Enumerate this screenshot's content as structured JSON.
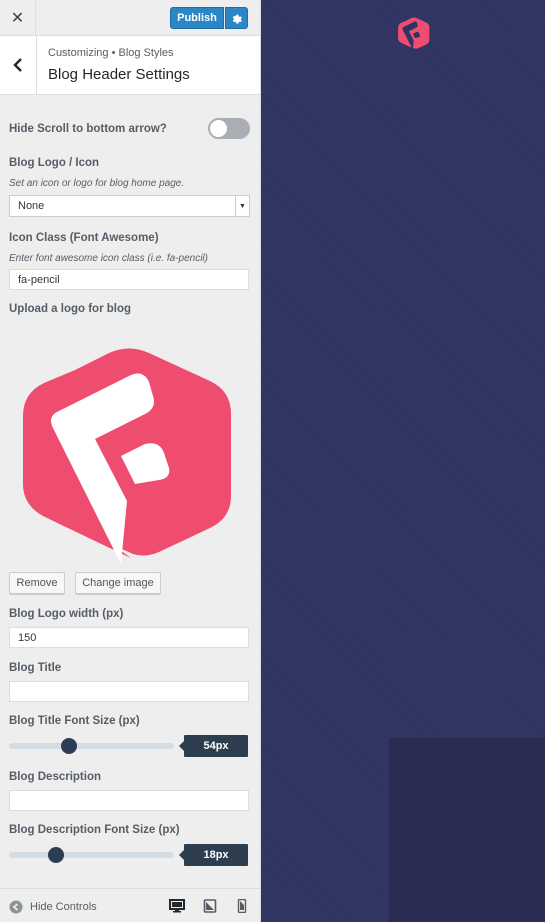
{
  "header": {
    "close_symbol": "✕",
    "publish_label": "Publish",
    "settings_icon": "gear-icon"
  },
  "section": {
    "breadcrumb": "Customizing • Blog Styles",
    "title": "Blog Header Settings"
  },
  "controls": {
    "scroll_arrow": {
      "label": "Hide Scroll to bottom arrow?",
      "enabled": false
    },
    "blog_logo_icon": {
      "label": "Blog Logo / Icon",
      "description": "Set an icon or logo for blog home page.",
      "selected": "None"
    },
    "icon_class": {
      "label": "Icon Class (Font Awesome)",
      "description": "Enter font awesome icon class (i.e. fa-pencil)",
      "value": "fa-pencil"
    },
    "upload_logo": {
      "label": "Upload a logo for blog",
      "remove_label": "Remove",
      "change_label": "Change image"
    },
    "logo_width": {
      "label": "Blog Logo width (px)",
      "value": "150"
    },
    "blog_title": {
      "label": "Blog Title",
      "value": ""
    },
    "title_font_size": {
      "label": "Blog Title Font Size (px)",
      "value_text": "54px",
      "slider_fraction": 0.35
    },
    "blog_description": {
      "label": "Blog Description",
      "value": ""
    },
    "desc_font_size": {
      "label": "Blog Description Font Size (px)",
      "value_text": "18px",
      "slider_fraction": 0.26
    }
  },
  "footer": {
    "hide_controls_label": "Hide Controls",
    "devices": [
      "desktop-icon",
      "tablet-icon",
      "mobile-icon"
    ]
  },
  "colors": {
    "accent": "#2b86c6",
    "brand_logo": "#ef4d6f",
    "preview_bg": "#2f3463",
    "slider_value_bg": "#2c3e50"
  }
}
